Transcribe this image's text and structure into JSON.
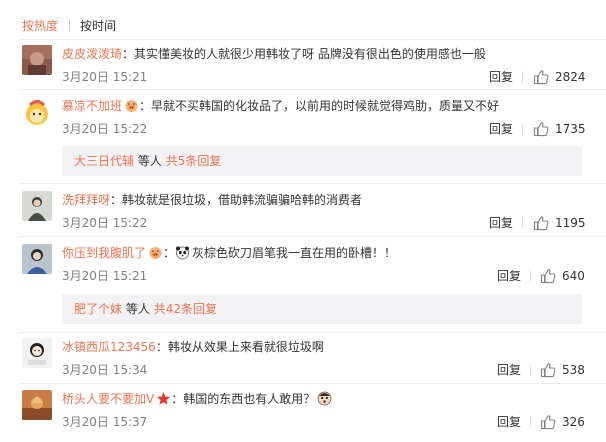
{
  "sort_tabs": {
    "hot": "按热度",
    "time": "按时间"
  },
  "reply_label": "回复",
  "colors": {
    "accent": "#eb7350",
    "text": "#333333",
    "muted": "#808080",
    "subreply_bg": "#f2f2f5"
  },
  "comments": [
    {
      "user": "皮皮泼泼琦",
      "text": "其实懂美妆的人就很少用韩妆了呀  品牌没有很出色的使用感也一般",
      "time": "3月20日 15:21",
      "likes": "2824"
    },
    {
      "user": "慕凉不加班",
      "text": "早就不买韩国的化妆品了，以前用的时候就觉得鸡肋，质量又不好",
      "time": "3月20日 15:22",
      "likes": "1735",
      "badge_icon": "pig-face-icon",
      "sub_replies": {
        "user": "大三日代辅",
        "middle": "等人",
        "total": "共5条回复"
      }
    },
    {
      "user": "洗拜拜呀",
      "text": "韩妆就是很垃圾，借助韩流骗骗哈韩的消费者",
      "time": "3月20日 15:22",
      "likes": "1195"
    },
    {
      "user": "你压到我腹肌了",
      "text": "灰棕色砍刀眉笔我一直在用的卧槽！！",
      "time": "3月20日 15:21",
      "likes": "640",
      "badge_icon": "pig-face-icon",
      "emoji_icon": "panda-icon",
      "sub_replies": {
        "user": "肥了个妹",
        "middle": "等人",
        "total": "共42条回复"
      }
    },
    {
      "user": "冰镇西瓜123456",
      "text": "韩妆从效果上来看就很垃圾啊",
      "time": "3月20日 15:34",
      "likes": "538"
    },
    {
      "user": "桥头人要不要加V",
      "text": "韩国的东西也有人敢用？",
      "time": "3月20日 15:37",
      "likes": "326",
      "badge_icon": "red-star-icon",
      "emoji_icon": "surprised-face-icon"
    }
  ]
}
